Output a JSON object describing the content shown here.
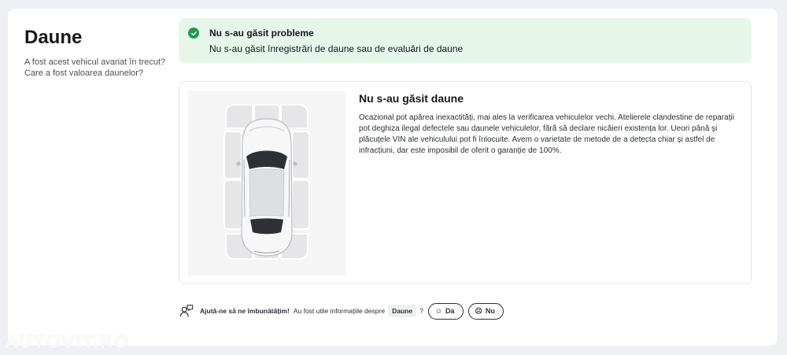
{
  "section": {
    "title": "Daune",
    "subtitle": "A fost acest vehicul avariat în trecut? Care a fost valoarea daunelor?"
  },
  "alert": {
    "icon": "check-circle-icon",
    "color": "#1e9e4a",
    "background": "#e6f7ea",
    "title": "Nu s-au găsit probleme",
    "text": "Nu s-au găsit înregistrări de daune sau de evaluări de daune"
  },
  "panel": {
    "title": "Nu s-au găsit daune",
    "text": "Ocazional pot apărea inexactități, mai ales la verificarea vehiculelor vechi. Atelierele clandestine de reparații pot deghiza ilegal defectele sau daunele vehiculelor, fără să declare nicăieri existența lor. Ueori până și plăcuțele VIN ale vehiculului pot fi înlocuite. Avem o varietate de metode de a detecta chiar și astfel de infracțiuni, dar este imposibil de oferit o garanție de 100%."
  },
  "feedback": {
    "icon": "user-feedback-icon",
    "strong": "Ajută-ne să ne îmbunătățim!",
    "question": "Au fost utile informațiile despre",
    "chip": "Daune",
    "question_mark": "?",
    "yes_label": "Da",
    "no_label": "Nu"
  },
  "watermark": "AUTOVIT.RO"
}
